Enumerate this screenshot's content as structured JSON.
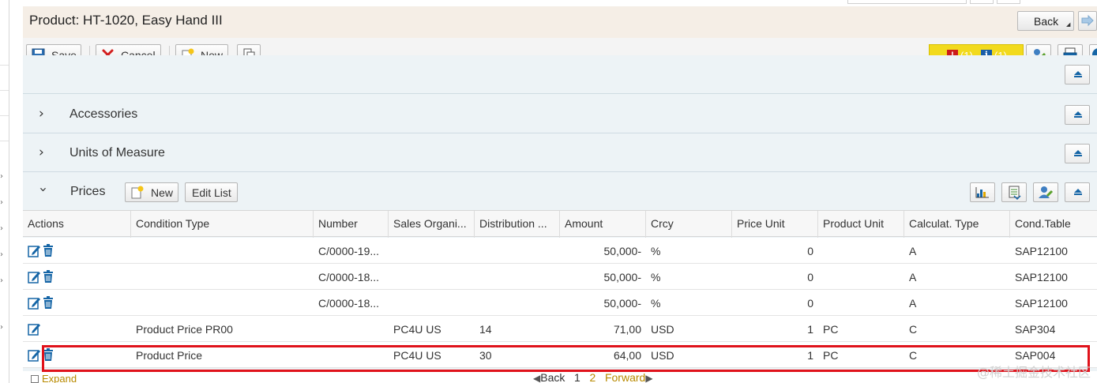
{
  "window": {
    "title": "Product: HT-1020, Easy Hand III",
    "back_label": "Back"
  },
  "toolbar": {
    "save_label": "Save",
    "cancel_label": "Cancel",
    "new_label": "New",
    "messages": {
      "error_count": "(1)",
      "info_count": "(1)"
    }
  },
  "sections": {
    "accessories": "Accessories",
    "units_of_measure": "Units of Measure",
    "prices": "Prices"
  },
  "prices": {
    "new_label": "New",
    "edit_list_label": "Edit List",
    "columns": [
      "Actions",
      "Condition Type",
      "Number",
      "Sales Organi...",
      "Distribution ...",
      "Amount",
      "Crcy",
      "Price Unit",
      "Product Unit",
      "Calculat. Type",
      "Cond.Table"
    ],
    "rows": [
      {
        "condition_type": "",
        "number": "C/0000-19...",
        "sales_org": "",
        "distribution": "",
        "amount": "50,000-",
        "crcy": "%",
        "price_unit": "0",
        "product_unit": "",
        "calc_type": "A",
        "cond_table": "SAP12100",
        "deletable": true
      },
      {
        "condition_type": "",
        "number": "C/0000-18...",
        "sales_org": "",
        "distribution": "",
        "amount": "50,000-",
        "crcy": "%",
        "price_unit": "0",
        "product_unit": "",
        "calc_type": "A",
        "cond_table": "SAP12100",
        "deletable": true
      },
      {
        "condition_type": "",
        "number": "C/0000-18...",
        "sales_org": "",
        "distribution": "",
        "amount": "50,000-",
        "crcy": "%",
        "price_unit": "0",
        "product_unit": "",
        "calc_type": "A",
        "cond_table": "SAP12100",
        "deletable": true
      },
      {
        "condition_type": "Product Price PR00",
        "number": "",
        "sales_org": "PC4U US",
        "distribution": "14",
        "amount": "71,00",
        "crcy": "USD",
        "price_unit": "1",
        "product_unit": "PC",
        "calc_type": "C",
        "cond_table": "SAP304",
        "deletable": false
      },
      {
        "condition_type": "Product Price",
        "number": "",
        "sales_org": "PC4U US",
        "distribution": "30",
        "amount": "64,00",
        "crcy": "USD",
        "price_unit": "1",
        "product_unit": "PC",
        "calc_type": "C",
        "cond_table": "SAP004",
        "deletable": true
      }
    ]
  },
  "footer": {
    "expand_label": "Expand",
    "back_label": "Back",
    "page_1": "1",
    "page_2": "2",
    "forward_label": "Forward"
  },
  "watermark": "@稀土掘金技术社区",
  "colors": {
    "accent_blue": "#1565a6",
    "highlight_red": "#e0121b",
    "message_yellow": "#f2da1d",
    "link_gold": "#b88a00",
    "title_bg": "#f5eee6",
    "section_bg": "#edf3f6"
  }
}
